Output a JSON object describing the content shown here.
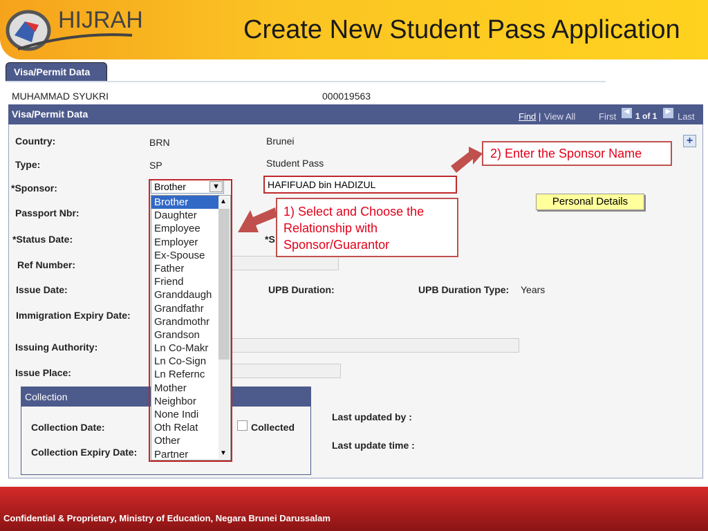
{
  "header": {
    "logo_text": "HIJRAH",
    "title": "Create New Student Pass Application"
  },
  "tab": {
    "label": "Visa/Permit Data"
  },
  "student": {
    "name": "MUHAMMAD SYUKRI",
    "id": "000019563"
  },
  "panel": {
    "title": "Visa/Permit Data",
    "find": "Find",
    "separator": "|",
    "view_all": "View All",
    "first": "First",
    "page": "1 of 1",
    "last": "Last",
    "add_icon": "plus-icon"
  },
  "fields": {
    "country_label": "Country:",
    "country_code": "BRN",
    "country_name": "Brunei",
    "type_label": "Type:",
    "type_code": "SP",
    "type_name": "Student Pass",
    "sponsor_label": "*Sponsor:",
    "sponsor_value": "Brother",
    "sponsor_name": "HAFIFUAD bin HADIZUL",
    "passport_label": "Passport Nbr:",
    "status_date_label": "*Status Date:",
    "status_partial": "*S",
    "ref_label": "Ref Number:",
    "issue_date_label": "Issue Date:",
    "upb_duration_label": "UPB Duration:",
    "upb_type_label": "UPB Duration Type:",
    "upb_type_value": "Years",
    "immigration_label": "Immigration Expiry Date:",
    "issuing_label": "Issuing Authority:",
    "issue_place_label": "Issue Place:",
    "last_updated_by": "Last updated by :",
    "last_update_time": "Last update time :"
  },
  "personal_details_button": "Personal Details",
  "collection": {
    "title": "Collection",
    "date_label": "Collection Date:",
    "expiry_label": "Collection Expiry Date:",
    "collected_label": "Collected",
    "collected": false
  },
  "dropdown": {
    "options": [
      "Brother",
      "Daughter",
      "Employee",
      "Employer",
      "Ex-Spouse",
      "Father",
      "Friend",
      "Granddaugh",
      "Grandfathr",
      "Grandmothr",
      "Grandson",
      "Ln Co-Makr",
      "Ln Co-Sign",
      "Ln Refernc",
      "Mother",
      "Neighbor",
      "None Indi",
      "Oth Relat",
      "Other",
      "Partner"
    ],
    "selected": "Brother"
  },
  "callouts": {
    "step1": "1) Select and Choose the Relationship with Sponsor/Guarantor",
    "step2": "2) Enter the Sponsor Name"
  },
  "footer": {
    "text": "Confidential & Proprietary, Ministry of Education, Negara Brunei Darussalam"
  },
  "colors": {
    "header_bar": "#4d5a8c",
    "callout_red": "#e2001a",
    "footer_red": "#c62828",
    "highlight": "#3169c6"
  }
}
